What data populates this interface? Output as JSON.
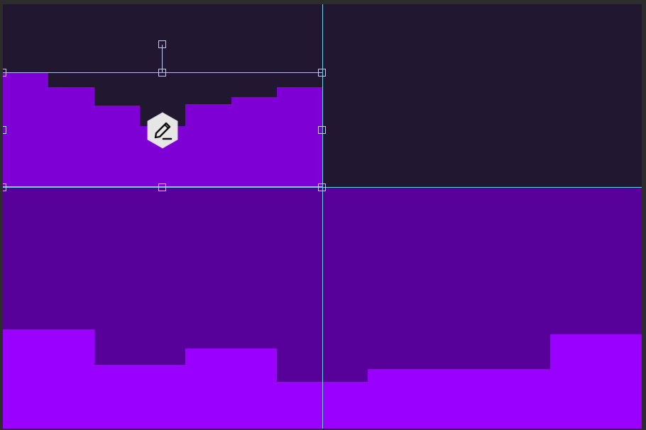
{
  "canvas": {
    "background_color": "#221731",
    "frame_color": "#2c2c2c",
    "guide_color": "#6fd3e6",
    "selection_color": "#c7c7f5"
  },
  "layers": {
    "selected_layer": {
      "color": "#7f00d5"
    },
    "middle_layer": {
      "color": "#58009a"
    },
    "bottom_layer": {
      "color": "#9a00ff"
    }
  },
  "tool_badge": {
    "icon": "pencil-edit-icon",
    "background": "#e6e6e6"
  },
  "handles": [
    "top-left",
    "top-center",
    "top-right",
    "middle-left",
    "middle-right",
    "bottom-left",
    "bottom-center",
    "bottom-right",
    "rotate"
  ]
}
